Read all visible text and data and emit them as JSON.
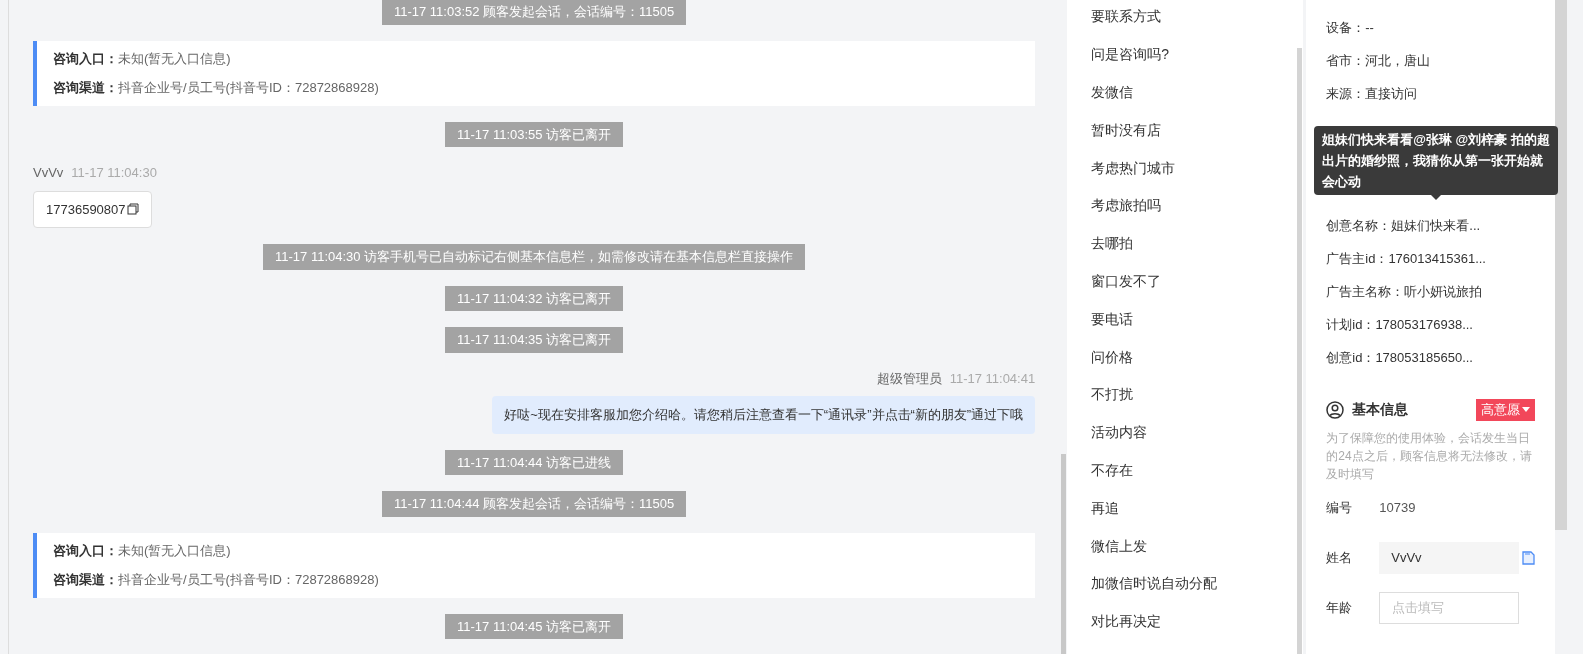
{
  "chat": {
    "messages": [
      {
        "kind": "system",
        "text": "11-17 11:03:52 顾客发起会话，会话编号：11505"
      },
      {
        "kind": "info",
        "rows": [
          {
            "label": "咨询入口：",
            "value": "未知(暂无入口信息)"
          },
          {
            "label": "咨询渠道：",
            "value": "抖音企业号/员工号(抖音号ID：72872868928)"
          }
        ]
      },
      {
        "kind": "system",
        "text": "11-17 11:03:55 访客已离开"
      },
      {
        "kind": "visitor",
        "sender": "VvVv",
        "time": "11-17 11:04:30",
        "text": "17736590807"
      },
      {
        "kind": "system",
        "text": "11-17 11:04:30 访客手机号已自动标记右侧基本信息栏，如需修改请在基本信息栏直接操作"
      },
      {
        "kind": "system",
        "text": "11-17 11:04:32 访客已离开"
      },
      {
        "kind": "system",
        "text": "11-17 11:04:35 访客已离开"
      },
      {
        "kind": "agent",
        "sender": "超级管理员",
        "time": "11-17 11:04:41",
        "text": "好哒~现在安排客服加您介绍哈。请您稍后注意查看一下“通讯录”并点击“新的朋友”通过下哦"
      },
      {
        "kind": "system",
        "text": "11-17 11:04:44 访客已进线"
      },
      {
        "kind": "system",
        "text": "11-17 11:04:44 顾客发起会话，会话编号：11505"
      },
      {
        "kind": "info",
        "rows": [
          {
            "label": "咨询入口：",
            "value": "未知(暂无入口信息)"
          },
          {
            "label": "咨询渠道：",
            "value": "抖音企业号/员工号(抖音号ID：72872868928)"
          }
        ]
      },
      {
        "kind": "system",
        "text": "11-17 11:04:45 访客已离开"
      }
    ]
  },
  "quick_replies": [
    "要联系方式",
    "问是咨询吗?",
    "发微信",
    "暂时没有店",
    "考虑热门城市",
    "考虑旅拍吗",
    "去哪拍",
    "窗口发不了",
    "要电话",
    "问价格",
    "不打扰",
    "活动内容",
    "不存在",
    "再追",
    "微信上发",
    "加微信时说自动分配",
    "对比再决定"
  ],
  "customer": {
    "fields": [
      {
        "kind": "row",
        "text": "设备：--"
      },
      {
        "kind": "row",
        "text": "省市：河北，唐山"
      },
      {
        "kind": "row",
        "text": "来源：直接访问"
      },
      {
        "kind": "hidden"
      },
      {
        "kind": "hidden"
      },
      {
        "kind": "hidden"
      },
      {
        "kind": "row",
        "text": "创意名称：姐妹们快来看..."
      },
      {
        "kind": "row",
        "text": "广告主id：176013415361..."
      },
      {
        "kind": "row",
        "text": "广告主名称：听小妍说旅拍"
      },
      {
        "kind": "row",
        "text": "计划id：178053176938..."
      },
      {
        "kind": "row",
        "text": "创意id：178053185650..."
      }
    ],
    "tooltip": "姐妹们快来看看@张琳 @刘梓豪 拍的超出片的婚纱照，我猜你从第一张开始就会心动",
    "basic_info": {
      "title": "基本信息",
      "tag": "高意愿",
      "notice": "为了保障您的使用体验，会话发生当日的24点之后，顾客信息将无法修改，请及时填写",
      "items": [
        {
          "kind": "text",
          "label": "编号",
          "value": "10739"
        },
        {
          "kind": "filled",
          "label": "姓名",
          "value": "VvVv"
        },
        {
          "kind": "input",
          "label": "年龄",
          "placeholder": "点击填写"
        }
      ]
    }
  }
}
